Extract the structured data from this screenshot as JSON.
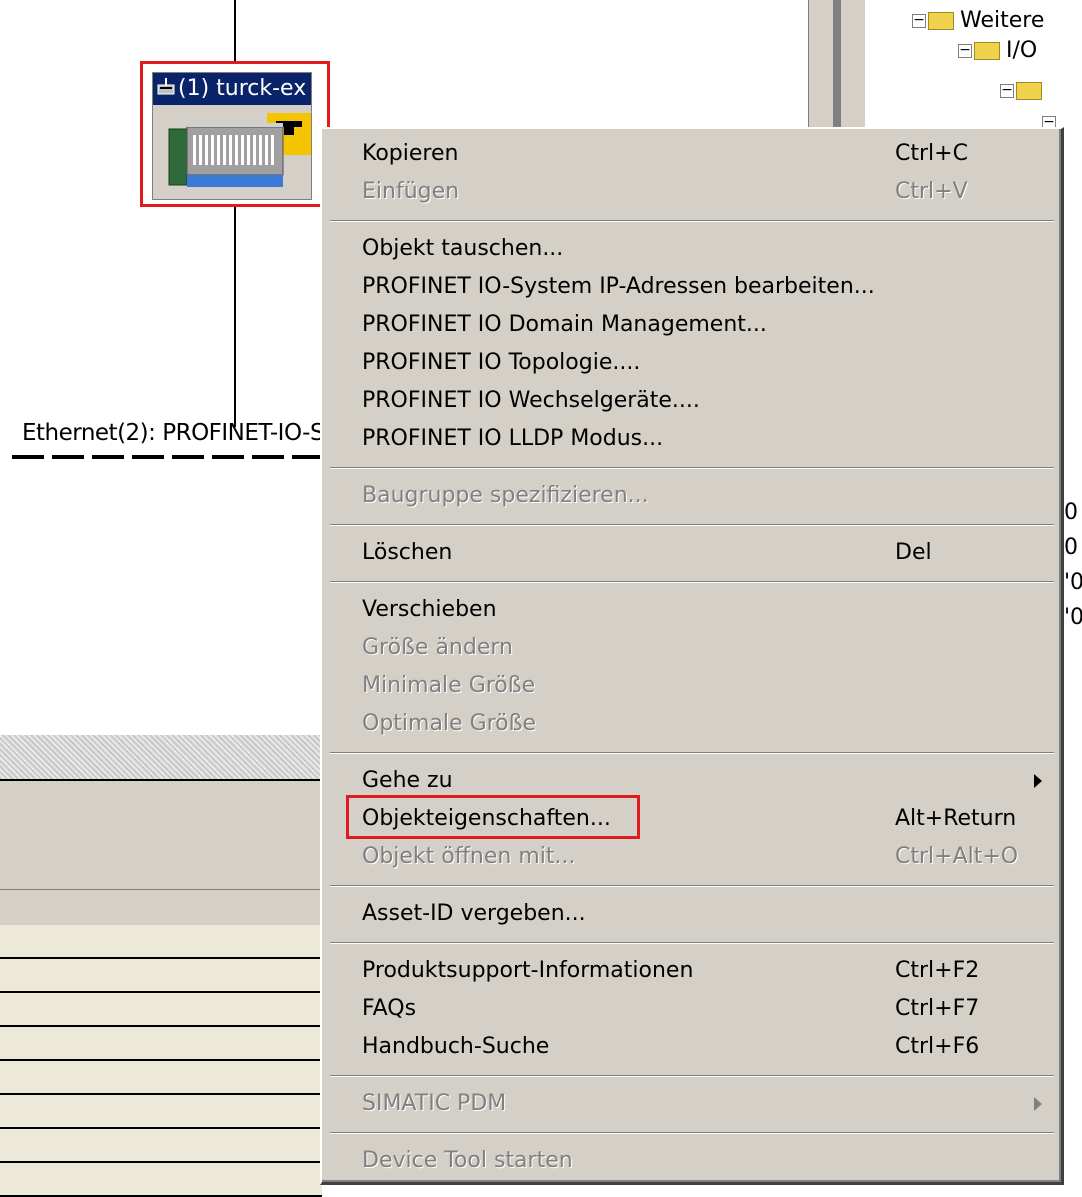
{
  "device": {
    "title": "(1) turck-ex",
    "icon": "profinet-device-icon",
    "badge_icon": "turck-t-badge-icon"
  },
  "network": {
    "ethernet_label": "Ethernet(2): PROFINET-IO-S"
  },
  "tree": {
    "items": [
      {
        "label": "Weitere"
      },
      {
        "label": "I/O"
      },
      {
        "label": ""
      },
      {
        "label": ""
      }
    ]
  },
  "truncated_right": [
    "0",
    "0",
    "'0",
    "'0"
  ],
  "context_menu": {
    "groups": [
      [
        {
          "label": "Kopieren",
          "shortcut": "Ctrl+C",
          "enabled": true
        },
        {
          "label": "Einfügen",
          "shortcut": "Ctrl+V",
          "enabled": false
        }
      ],
      [
        {
          "label": "Objekt tauschen...",
          "shortcut": "",
          "enabled": true
        },
        {
          "label": "PROFINET IO-System IP-Adressen bearbeiten...",
          "shortcut": "",
          "enabled": true
        },
        {
          "label": "PROFINET IO Domain Management...",
          "shortcut": "",
          "enabled": true
        },
        {
          "label": "PROFINET IO Topologie....",
          "shortcut": "",
          "enabled": true
        },
        {
          "label": "PROFINET IO Wechselgeräte....",
          "shortcut": "",
          "enabled": true
        },
        {
          "label": "PROFINET IO LLDP Modus...",
          "shortcut": "",
          "enabled": true
        }
      ],
      [
        {
          "label": "Baugruppe spezifizieren...",
          "shortcut": "",
          "enabled": false
        }
      ],
      [
        {
          "label": "Löschen",
          "shortcut": "Del",
          "enabled": true
        }
      ],
      [
        {
          "label": "Verschieben",
          "shortcut": "",
          "enabled": true
        },
        {
          "label": "Größe ändern",
          "shortcut": "",
          "enabled": false
        },
        {
          "label": "Minimale Größe",
          "shortcut": "",
          "enabled": false
        },
        {
          "label": "Optimale Größe",
          "shortcut": "",
          "enabled": false
        }
      ],
      [
        {
          "label": "Gehe zu",
          "shortcut": "",
          "enabled": true,
          "submenu": true
        },
        {
          "label": "Objekteigenschaften...",
          "shortcut": "Alt+Return",
          "enabled": true,
          "highlighted": true
        },
        {
          "label": "Objekt öffnen mit...",
          "shortcut": "Ctrl+Alt+O",
          "enabled": false
        }
      ],
      [
        {
          "label": "Asset-ID vergeben...",
          "shortcut": "",
          "enabled": true
        }
      ],
      [
        {
          "label": "Produktsupport-Informationen",
          "shortcut": "Ctrl+F2",
          "enabled": true
        },
        {
          "label": "FAQs",
          "shortcut": "Ctrl+F7",
          "enabled": true
        },
        {
          "label": "Handbuch-Suche",
          "shortcut": "Ctrl+F6",
          "enabled": true
        }
      ],
      [
        {
          "label": "SIMATIC PDM",
          "shortcut": "",
          "enabled": false,
          "submenu": true
        }
      ],
      [
        {
          "label": "Device Tool starten",
          "shortcut": "",
          "enabled": false
        }
      ]
    ]
  },
  "colors": {
    "highlight_border": "#e01b1b",
    "menu_bg": "#d4d0c8",
    "title_bar": "#0a246a",
    "badge": "#f5c400"
  }
}
